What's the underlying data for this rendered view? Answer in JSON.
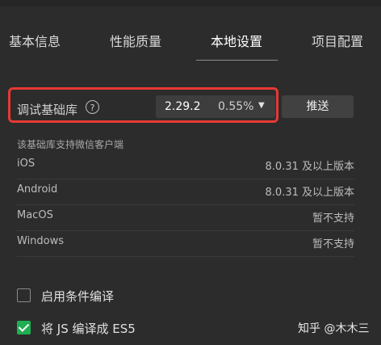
{
  "tabs": [
    {
      "label": "基本信息",
      "active": false
    },
    {
      "label": "性能质量",
      "active": false
    },
    {
      "label": "本地设置",
      "active": true
    },
    {
      "label": "项目配置",
      "active": false
    }
  ],
  "debug_lib": {
    "label": "调试基础库",
    "help_icon": "?",
    "version": "2.29.2",
    "percent": "0.55%",
    "caret": "▼",
    "push_label": "推送"
  },
  "support": {
    "note": "该基础库支持微信客户端",
    "rows": [
      {
        "name": "iOS",
        "value": "8.0.31 及以上版本"
      },
      {
        "name": "Android",
        "value": "8.0.31 及以上版本"
      },
      {
        "name": "MacOS",
        "value": "暂不支持"
      },
      {
        "name": "Windows",
        "value": "暂不支持"
      }
    ]
  },
  "options": [
    {
      "label": "启用条件编译",
      "checked": false
    },
    {
      "label": "将 JS 编译成 ES5",
      "checked": true
    }
  ],
  "watermark": "知乎 @木木三",
  "colors": {
    "background": "#2c2c2c",
    "highlight": "#e53935",
    "checkbox_on": "#1fae52"
  }
}
